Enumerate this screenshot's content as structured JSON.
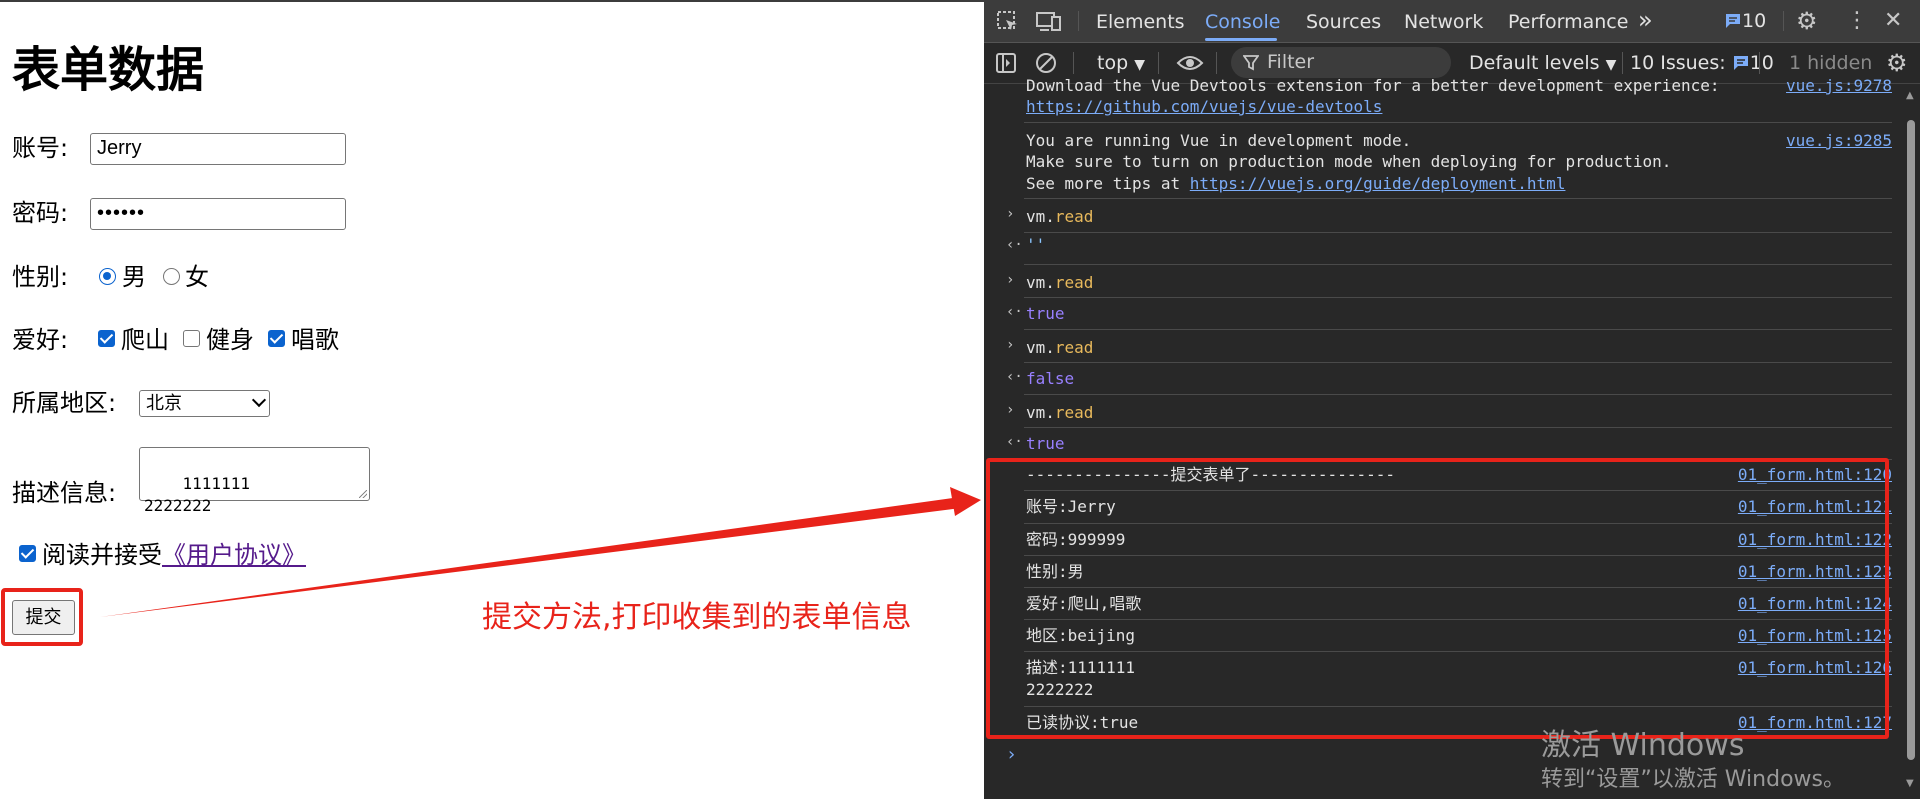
{
  "form": {
    "title": "表单数据",
    "account_label": "账号:",
    "account_value": "Jerry",
    "password_label": "密码:",
    "password_value": "••••••",
    "gender_label": "性别:",
    "gender_options": [
      "男",
      "女"
    ],
    "gender_selected": "男",
    "hobby_label": "爱好:",
    "hobbies": [
      {
        "label": "爬山",
        "checked": true
      },
      {
        "label": "健身",
        "checked": false
      },
      {
        "label": "唱歌",
        "checked": true
      }
    ],
    "region_label": "所属地区:",
    "region_value": "北京",
    "desc_label": "描述信息:",
    "desc_value": "1111111\n2222222",
    "agree_text": "阅读并接受",
    "agree_link": "《用户协议》",
    "agree_checked": true,
    "submit_label": "提交"
  },
  "annotation": {
    "text": "提交方法,打印收集到的表单信息",
    "color": "#e8231a"
  },
  "devtools": {
    "tabs": [
      "Elements",
      "Console",
      "Sources",
      "Network",
      "Performance"
    ],
    "active_tab": "Console",
    "more_tabs": "»",
    "message_count": "10",
    "context": "top",
    "filter_placeholder": "Filter",
    "levels": "Default levels",
    "issues_label": "10 Issues:",
    "issues_count": "10",
    "hidden": "1 hidden",
    "console": {
      "devtools_msg_line1": "Download the Vue Devtools extension for a better development experience:",
      "devtools_msg_link": "https://github.com/vuejs/vue-devtools",
      "devtools_msg_src": "vue.js:9278",
      "devmode_line1": "You are running Vue in development mode.",
      "devmode_line2": "Make sure to turn on production mode when deploying for production.",
      "devmode_line3_prefix": "See more tips at ",
      "devmode_line3_link": "https://vuejs.org/guide/deployment.html",
      "devmode_src": "vue.js:9285",
      "eval_obj": "vm.",
      "eval_prop": "read",
      "results": [
        "''",
        "true",
        "false",
        "true"
      ],
      "log_rows": [
        {
          "text": "---------------提交表单了---------------",
          "src": "01_form.html:120"
        },
        {
          "text": "账号:Jerry",
          "src": "01_form.html:121"
        },
        {
          "text": "密码:999999",
          "src": "01_form.html:122"
        },
        {
          "text": "性别:男",
          "src": "01_form.html:123"
        },
        {
          "text": "爱好:爬山,唱歌",
          "src": "01_form.html:124"
        },
        {
          "text": "地区:beijing",
          "src": "01_form.html:125"
        },
        {
          "text": "描述:1111111",
          "src": "01_form.html:126"
        },
        {
          "text": "已读协议:true",
          "src": "01_form.html:127"
        }
      ],
      "desc_second_line": "2222222"
    }
  },
  "watermark": {
    "line1": "激活 Windows",
    "line2": "转到“设置”以激活 Windows。"
  }
}
